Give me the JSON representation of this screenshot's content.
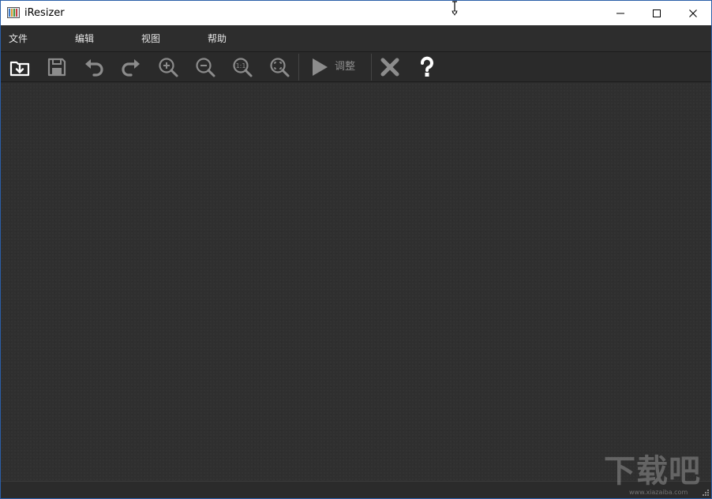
{
  "window": {
    "title": "iResizer"
  },
  "menu": {
    "items": [
      {
        "label": "文件"
      },
      {
        "label": "编辑"
      },
      {
        "label": "视图"
      },
      {
        "label": "帮助"
      }
    ]
  },
  "toolbar": {
    "buttons": [
      {
        "icon": "open-folder-icon"
      },
      {
        "icon": "save-icon"
      },
      {
        "icon": "undo-icon"
      },
      {
        "icon": "redo-icon"
      },
      {
        "icon": "zoom-in-icon"
      },
      {
        "icon": "zoom-out-icon"
      },
      {
        "icon": "zoom-actual-size-icon",
        "text": "1:1"
      },
      {
        "icon": "zoom-fit-icon"
      },
      {
        "icon": "play-icon"
      },
      {
        "icon": "close-x-icon"
      },
      {
        "icon": "help-icon"
      }
    ],
    "run_label": "调整"
  },
  "watermark": {
    "main": "下载吧",
    "sub": "www.xiazaiba.com"
  },
  "colors": {
    "background": "#2f2f2f",
    "toolbar": "#2a2a2a",
    "icon_active": "#ffffff",
    "icon_disabled": "#8c8c8c"
  }
}
